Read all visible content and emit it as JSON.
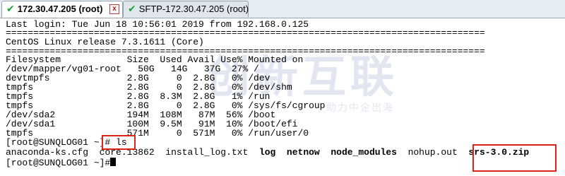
{
  "tabs": [
    {
      "label": "172.30.47.205 (root)",
      "status_icon": "check-icon",
      "active": true
    },
    {
      "label": "SFTP-172.30.47.205 (root)",
      "status_icon": "check-icon",
      "active": false
    }
  ],
  "watermark": {
    "logo": "创新互联",
    "tagline": "助力中企出海"
  },
  "terminal": {
    "lines": [
      "Last login: Tue Jun 18 10:56:01 2019 from 192.168.0.125",
      "=======================================================================================",
      "CentOS Linux release 7.3.1611 (Core)",
      "=======================================================================================",
      "Filesystem            Size  Used Avail Use% Mounted on",
      "/dev/mapper/vg01-root   50G   14G   37G  27% /",
      "devtmpfs              2.8G     0  2.8G   0% /dev",
      "tmpfs                 2.8G     0  2.8G   0% /dev/shm",
      "tmpfs                 2.8G  8.3M  2.8G   1% /run",
      "tmpfs                 2.8G     0  2.8G   0% /sys/fs/cgroup",
      "/dev/sda2             194M  108M   87M  56% /boot",
      "/dev/sda1             100M  9.5M   91M  10% /boot/efi",
      "tmpfs                 571M     0  571M   0% /run/user/0"
    ],
    "prompt1": "[root@SUNQLOG01 ~]",
    "command1": "# ls",
    "ls_output": [
      {
        "name": "anaconda-ks.cfg",
        "bold": false
      },
      {
        "name": "core.13862",
        "bold": false
      },
      {
        "name": "install_log.txt",
        "bold": false
      },
      {
        "name": "log",
        "bold": true
      },
      {
        "name": "netnow",
        "bold": true
      },
      {
        "name": "node_modules",
        "bold": true
      },
      {
        "name": "nohup.out",
        "bold": false
      },
      {
        "name": "srs-3.0.zip",
        "bold": true
      }
    ],
    "prompt2": "[root@SUNQLOG01 ~]#"
  },
  "colors": {
    "highlight": "#e0231a",
    "tab_check": "#1aa53a"
  }
}
